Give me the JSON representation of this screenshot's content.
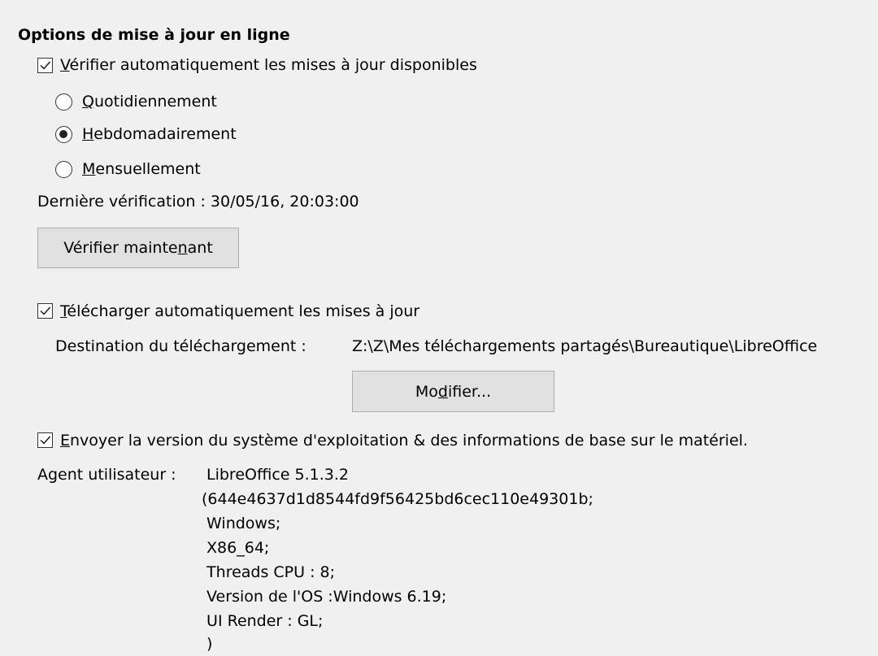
{
  "section_title": "Options de mise à jour en ligne",
  "auto_check": {
    "checked": true,
    "label_prefix": "",
    "label_mnemonic": "V",
    "label_rest": "érifier automatiquement les mises à jour disponibles"
  },
  "frequency": {
    "options": [
      {
        "mnemonic": "Q",
        "rest": "uotidiennement",
        "selected": false
      },
      {
        "mnemonic": "H",
        "rest": "ebdomadairement",
        "selected": true
      },
      {
        "mnemonic": "M",
        "rest": "ensuellement",
        "selected": false
      }
    ]
  },
  "last_check": "Dernière vérification : 30/05/16, 20:03:00",
  "check_now_button": {
    "prefix": "Vérifier mainte",
    "mnemonic": "n",
    "rest": "ant"
  },
  "auto_download": {
    "checked": true,
    "label_mnemonic": "T",
    "label_rest": "élécharger automatiquement les mises à jour"
  },
  "download_destination": {
    "label": "Destination du téléchargement :",
    "path": "Z:\\Z\\Mes téléchargements partagés\\Bureautique\\LibreOffice"
  },
  "modify_button": {
    "prefix": "Mo",
    "mnemonic": "d",
    "rest": "ifier..."
  },
  "send_os_info": {
    "checked": true,
    "label_mnemonic": "E",
    "label_rest": "nvoyer la version du système d'exploitation & des informations de base sur le matériel."
  },
  "user_agent": {
    "label": "Agent utilisateur :",
    "lines": [
      "LibreOffice 5.1.3.2",
      "(644e4637d1d8544fd9f56425bd6cec110e49301b;",
      " Windows;",
      " X86_64;",
      " Threads CPU : 8;",
      " Version de l'OS :Windows 6.19;",
      " UI Render : GL;",
      " )"
    ]
  },
  "colors": {
    "background": "#f0f0f0",
    "button_face": "#e1e1e1",
    "button_border": "#adadad"
  }
}
